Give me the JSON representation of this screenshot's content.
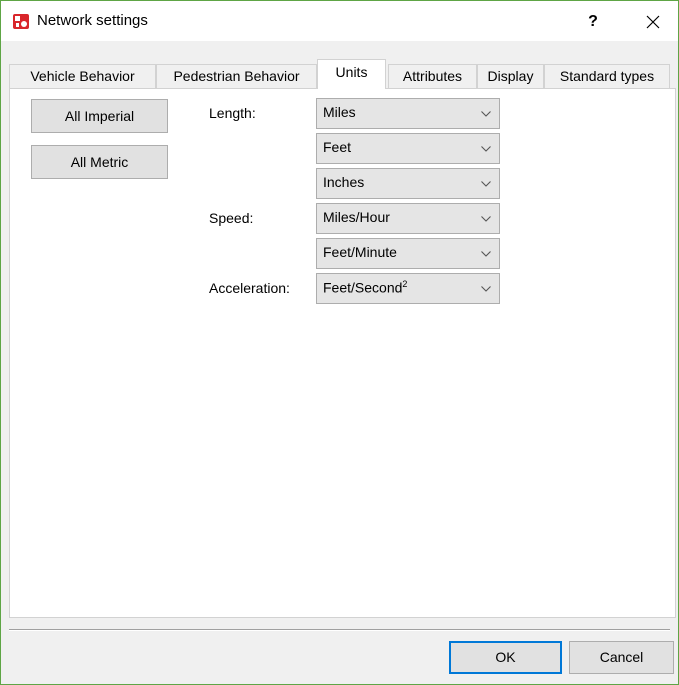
{
  "window": {
    "title": "Network settings",
    "help_label": "?",
    "icon": "app-logo-icon",
    "accent_color": "#d9262b"
  },
  "tabs": [
    {
      "label": "Vehicle Behavior",
      "active": false
    },
    {
      "label": "Pedestrian Behavior",
      "active": false
    },
    {
      "label": "Units",
      "active": true
    },
    {
      "label": "Attributes",
      "active": false
    },
    {
      "label": "Display",
      "active": false
    },
    {
      "label": "Standard types",
      "active": false
    }
  ],
  "units": {
    "presets": {
      "imperial_label": "All Imperial",
      "metric_label": "All Metric"
    },
    "length": {
      "label": "Length:",
      "values": [
        "Miles",
        "Feet",
        "Inches"
      ]
    },
    "speed": {
      "label": "Speed:",
      "values": [
        "Miles/Hour",
        "Feet/Minute"
      ]
    },
    "acceleration": {
      "label": "Acceleration:",
      "value": "Feet/Second",
      "superscript": "2"
    }
  },
  "footer": {
    "ok_label": "OK",
    "cancel_label": "Cancel"
  }
}
